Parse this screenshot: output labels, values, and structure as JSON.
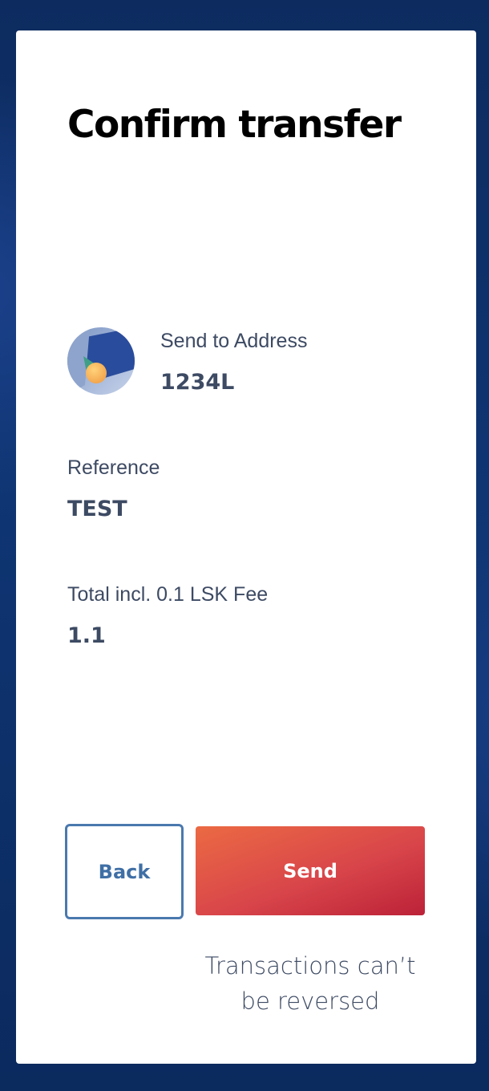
{
  "dialog": {
    "title": "Confirm transfer"
  },
  "recipient": {
    "label": "Send to Address",
    "address": "1234L",
    "avatar_icon": "account-avatar-icon"
  },
  "reference": {
    "label": "Reference",
    "value": "TEST"
  },
  "total": {
    "label": "Total incl. 0.1 LSK Fee",
    "value": "1.1"
  },
  "actions": {
    "back_label": "Back",
    "send_label": "Send"
  },
  "warning": {
    "line1": "Transactions can’t",
    "line2": "be reversed"
  },
  "colors": {
    "background": "#0b2a5e",
    "card": "#ffffff",
    "text": "#3d4a63",
    "back_border": "#4a79ae",
    "send_gradient_start": "#eb6a43",
    "send_gradient_end": "#bc2238"
  }
}
